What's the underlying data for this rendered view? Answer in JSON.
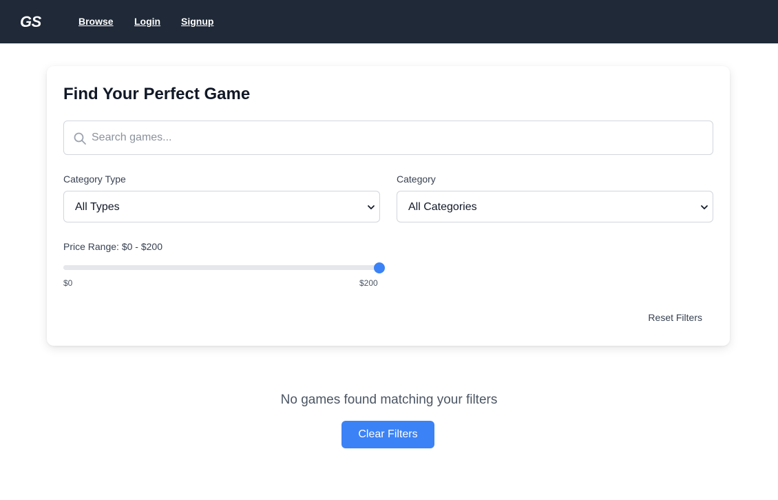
{
  "navbar": {
    "logo": "GS",
    "links": [
      "Browse",
      "Login",
      "Signup"
    ]
  },
  "filters": {
    "title": "Find Your Perfect Game",
    "search": {
      "placeholder": "Search games...",
      "value": ""
    },
    "category_type": {
      "label": "Category Type",
      "selected": "All Types"
    },
    "category": {
      "label": "Category",
      "selected": "All Categories"
    },
    "price": {
      "label": "Price Range: $0 - $200",
      "min_label": "$0",
      "max_label": "$200",
      "value": 200,
      "max": 200
    },
    "reset_label": "Reset Filters"
  },
  "results": {
    "empty_message": "No games found matching your filters",
    "clear_label": "Clear Filters"
  },
  "colors": {
    "navbar_bg": "#1f2937",
    "accent": "#3b82f6"
  }
}
